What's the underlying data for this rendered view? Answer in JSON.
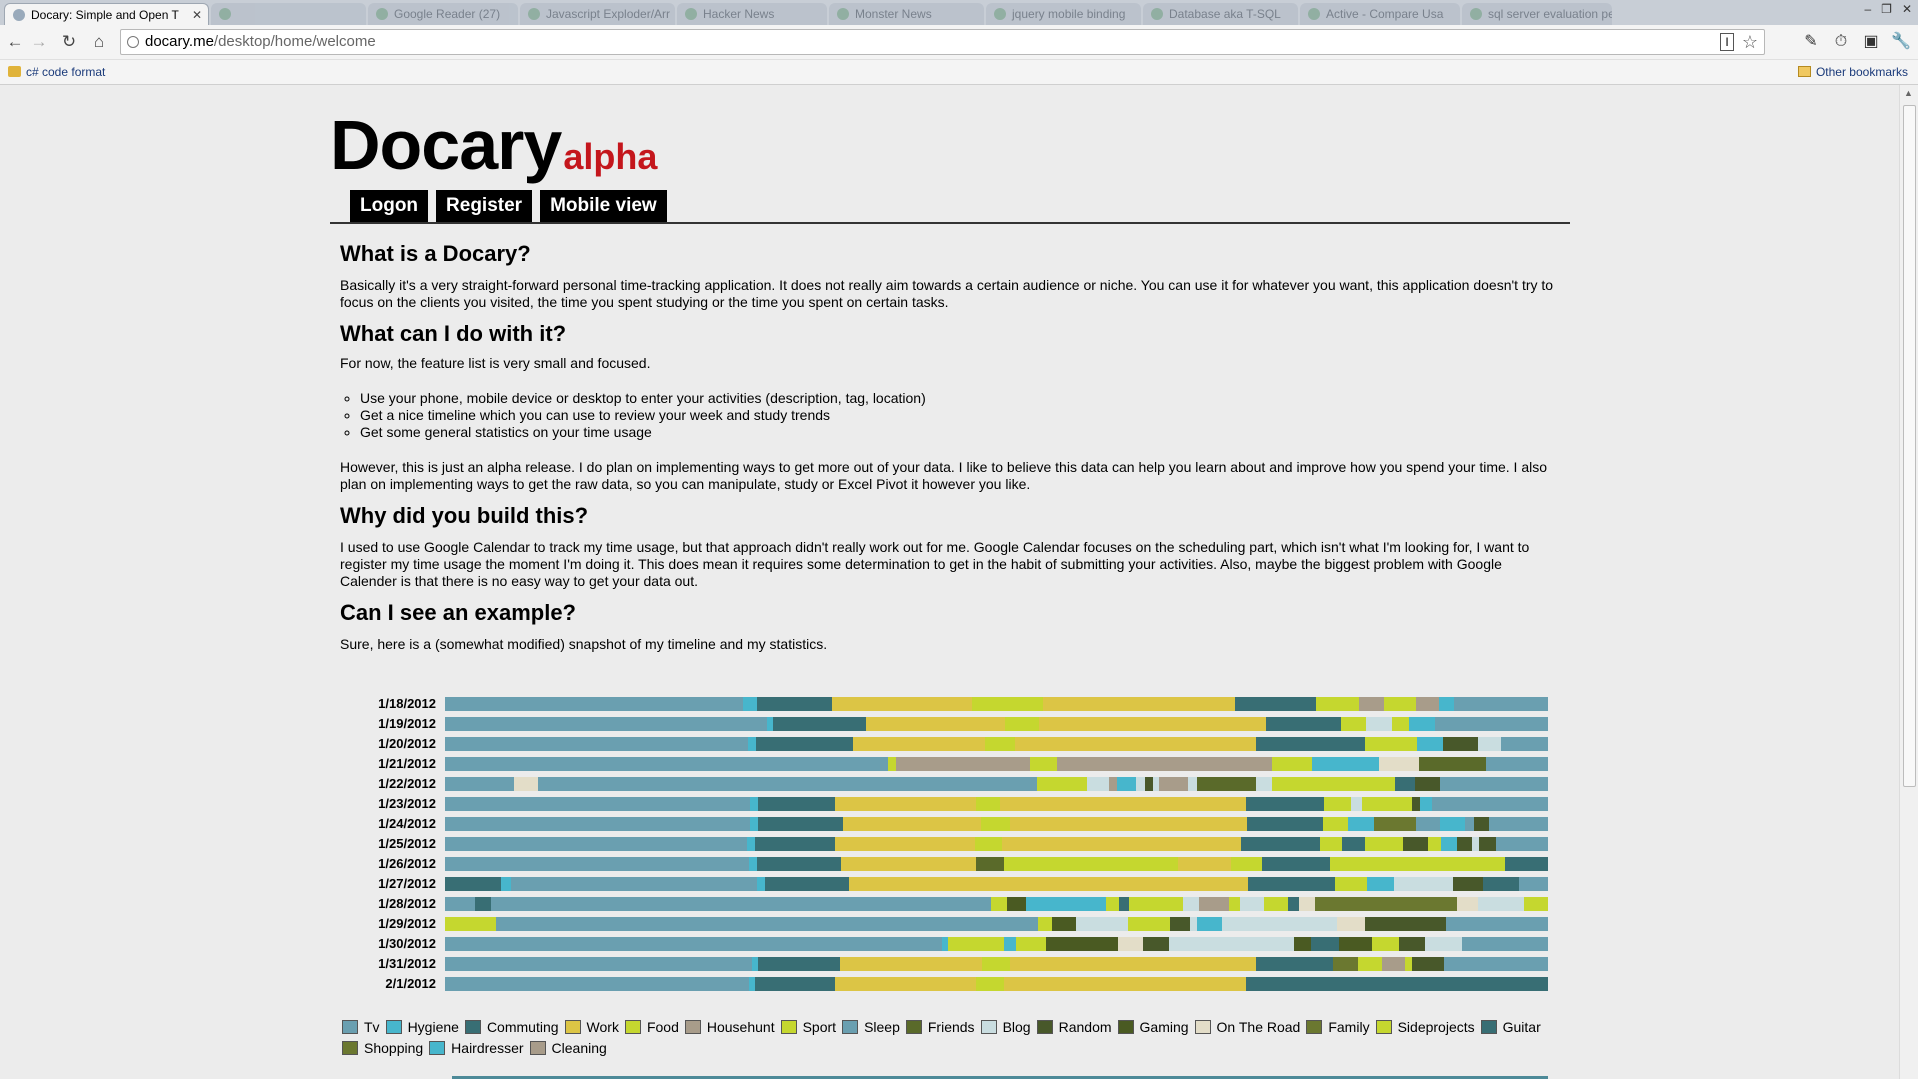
{
  "browser": {
    "tabs": [
      {
        "title": "Docary: Simple and Open T",
        "active": true
      },
      {
        "title": "",
        "active": false
      },
      {
        "title": "Google Reader (27)",
        "active": false
      },
      {
        "title": "Javascript Exploder/Arr",
        "active": false
      },
      {
        "title": "Hacker News",
        "active": false
      },
      {
        "title": "Monster News",
        "active": false
      },
      {
        "title": "jquery mobile binding",
        "active": false
      },
      {
        "title": "Database aka T-SQL",
        "active": false
      },
      {
        "title": "Active - Compare Usa",
        "active": false
      },
      {
        "title": "sql server evaluation pe",
        "active": false
      }
    ],
    "url_host": "docary.me",
    "url_path": "/desktop/home/welcome",
    "bookmarks": {
      "left": "c# code format",
      "right": "Other bookmarks"
    }
  },
  "page": {
    "logo": {
      "name": "Docary",
      "tag": "alpha"
    },
    "menu": [
      "Logon",
      "Register",
      "Mobile view"
    ],
    "sections": {
      "what_heading": "What is a Docary?",
      "what_text": "Basically it's a very straight-forward personal time-tracking application. It does not really aim towards a certain audience or niche. You can use it for whatever you want, this application doesn't try to focus on the clients you visited, the time you spent studying or the time you spent on certain tasks.",
      "do_heading": "What can I do with it?",
      "do_intro": "For now, the feature list is very small and focused.",
      "do_list": [
        "Use your phone, mobile device or desktop to enter your activities (description, tag, location)",
        "Get a nice timeline which you can use to review your week and study trends",
        "Get some general statistics on your time usage"
      ],
      "do_outro": "However, this is just an alpha release. I do plan on implementing ways to get more out of your data. I like to believe this data can help you learn about and improve how you spend your time. I also plan on implementing ways to get the raw data, so you can manipulate, study or Excel Pivot it however you like.",
      "why_heading": "Why did you build this?",
      "why_text": "I used to use Google Calendar to track my time usage, but that approach didn't really work out for me. Google Calendar focuses on the scheduling part, which isn't what I'm looking for, I want to register my time usage the moment I'm doing it. This does mean it requires some determination to get in the habit of submitting your activities. Also, maybe the biggest problem with Google Calender is that there is no easy way to get your data out.",
      "example_heading": "Can I see an example?",
      "example_text": "Sure, here is a (somewhat modified) snapshot of my timeline and my statistics."
    }
  },
  "colors": {
    "Tv": "#6a9fb0",
    "Hygiene": "#47b6cc",
    "Commuting": "#386e74",
    "Work": "#dcc545",
    "Food": "#c5d72f",
    "Househunt": "#a89c8a",
    "Sport": "#c5d72f",
    "Sleep": "#6a9fb0",
    "Friends": "#5a6a2a",
    "Blog": "#c9dde0",
    "Random": "#48582a",
    "Gaming": "#4a5a22",
    "On The Road": "#e3ddc8",
    "Family": "#6b7830",
    "Sideprojects": "#c5d72f",
    "Guitar": "#386e74",
    "Shopping": "#6b7830",
    "Hairdresser": "#47b6cc",
    "Cleaning": "#a89c8a"
  },
  "chart_data": {
    "type": "timeline",
    "legend": [
      "Tv",
      "Hygiene",
      "Commuting",
      "Work",
      "Food",
      "Househunt",
      "Sport",
      "Sleep",
      "Friends",
      "Blog",
      "Random",
      "Gaming",
      "On The Road",
      "Family",
      "Sideprojects",
      "Guitar",
      "Shopping",
      "Hairdresser",
      "Cleaning"
    ],
    "days": [
      {
        "date": "1/18/2012",
        "segments": [
          [
            "Sleep",
            30.3
          ],
          [
            "Hygiene",
            1.4
          ],
          [
            "Commuting",
            7.6
          ],
          [
            "Work",
            14.2
          ],
          [
            "Food",
            7.2
          ],
          [
            "Work",
            19.5
          ],
          [
            "Commuting",
            8.2
          ],
          [
            "Food",
            2.3
          ],
          [
            "Sport",
            2.1
          ],
          [
            "Househunt",
            2.6
          ],
          [
            "Food",
            3.2
          ],
          [
            "Cleaning",
            2.3
          ],
          [
            "Hygiene",
            1.6
          ],
          [
            "Tv",
            9.5
          ]
        ]
      },
      {
        "date": "1/19/2012",
        "segments": [
          [
            "Sleep",
            30.4
          ],
          [
            "Hygiene",
            0.6
          ],
          [
            "Commuting",
            8.7
          ],
          [
            "Work",
            13.2
          ],
          [
            "Food",
            3.2
          ],
          [
            "Work",
            21.4
          ],
          [
            "Commuting",
            7.1
          ],
          [
            "Food",
            2.3
          ],
          [
            "Blog",
            2.5
          ],
          [
            "Food",
            1.6
          ],
          [
            "Hygiene",
            2.4
          ],
          [
            "Tv",
            10.7
          ]
        ]
      },
      {
        "date": "1/20/2012",
        "segments": [
          [
            "Sleep",
            30.4
          ],
          [
            "Hygiene",
            0.8
          ],
          [
            "Commuting",
            9.7
          ],
          [
            "Work",
            13.2
          ],
          [
            "Food",
            3.1
          ],
          [
            "Work",
            24.1
          ],
          [
            "Commuting",
            11
          ],
          [
            "Food",
            5.2
          ],
          [
            "Hygiene",
            2.6
          ],
          [
            "Random",
            3.5
          ],
          [
            "Blog",
            2.3
          ],
          [
            "Tv",
            4.7
          ]
        ]
      },
      {
        "date": "1/21/2012",
        "segments": [
          [
            "Sleep",
            44.3
          ],
          [
            "Food",
            0.8
          ],
          [
            "Househunt",
            13.5
          ],
          [
            "Sport",
            2.7
          ],
          [
            "Househunt",
            21.5
          ],
          [
            "Food",
            4
          ],
          [
            "Hygiene",
            6.7
          ],
          [
            "On The Road",
            4
          ],
          [
            "Friends",
            6.7
          ],
          [
            "Tv",
            6.2
          ]
        ]
      },
      {
        "date": "1/22/2012",
        "segments": [
          [
            "Sleep",
            6.8
          ],
          [
            "On The Road",
            2.4
          ],
          [
            "Tv",
            49.4
          ],
          [
            "Food",
            5
          ],
          [
            "Blog",
            2.1
          ],
          [
            "Househunt",
            0.8
          ],
          [
            "Hygiene",
            1.9
          ],
          [
            "Blog",
            0.9
          ],
          [
            "Random",
            0.8
          ],
          [
            "Blog",
            0.6
          ],
          [
            "Cleaning",
            2.9
          ],
          [
            "Blog",
            0.9
          ],
          [
            "Friends",
            5.8
          ],
          [
            "Blog",
            1.6
          ],
          [
            "Sport",
            12.2
          ],
          [
            "Commuting",
            1.9
          ],
          [
            "Random",
            2.5
          ],
          [
            "Tv",
            10.7
          ]
        ]
      },
      {
        "date": "1/23/2012",
        "segments": [
          [
            "Sleep",
            30.5
          ],
          [
            "Hygiene",
            0.8
          ],
          [
            "Commuting",
            7.7
          ],
          [
            "Work",
            14.2
          ],
          [
            "Food",
            2.4
          ],
          [
            "Work",
            24.6
          ],
          [
            "Commuting",
            7.8
          ],
          [
            "Food",
            2.7
          ],
          [
            "Blog",
            1.1
          ],
          [
            "Food",
            5
          ],
          [
            "Random",
            0.8
          ],
          [
            "Hygiene",
            1.2
          ],
          [
            "Tv",
            11.6
          ]
        ]
      },
      {
        "date": "1/24/2012",
        "segments": [
          [
            "Sleep",
            30.4
          ],
          [
            "Hygiene",
            0.8
          ],
          [
            "Commuting",
            8.4
          ],
          [
            "Work",
            13.8
          ],
          [
            "Food",
            2.8
          ],
          [
            "Work",
            23.6
          ],
          [
            "Commuting",
            7.6
          ],
          [
            "Food",
            2.5
          ],
          [
            "Hygiene",
            2.6
          ],
          [
            "Family",
            4.2
          ],
          [
            "Tv",
            2.4
          ],
          [
            "Hygiene",
            2.4
          ],
          [
            "Tv",
            0.9
          ],
          [
            "Random",
            1.5
          ],
          [
            "Tv",
            5.9
          ]
        ]
      },
      {
        "date": "1/25/2012",
        "segments": [
          [
            "Sleep",
            30.4
          ],
          [
            "Hygiene",
            0.8
          ],
          [
            "Commuting",
            8
          ],
          [
            "Work",
            14.1
          ],
          [
            "Food",
            2.8
          ],
          [
            "Work",
            24
          ],
          [
            "Commuting",
            8
          ],
          [
            "Food",
            2.2
          ],
          [
            "Commuting",
            2.3
          ],
          [
            "Food",
            3.8
          ],
          [
            "Random",
            2.5
          ],
          [
            "Food",
            1.3
          ],
          [
            "Hygiene",
            1.7
          ],
          [
            "Random",
            1.5
          ],
          [
            "Blog",
            0.7
          ],
          [
            "Random",
            1.7
          ],
          [
            "Tv",
            5.2
          ]
        ]
      },
      {
        "date": "1/26/2012",
        "segments": [
          [
            "Sleep",
            30.3
          ],
          [
            "Hygiene",
            0.8
          ],
          [
            "Commuting",
            8.4
          ],
          [
            "Work",
            13.5
          ],
          [
            "Friends",
            2.8
          ],
          [
            "Sport",
            17.3
          ],
          [
            "Work",
            5.3
          ],
          [
            "Sport",
            3.1
          ],
          [
            "Commuting",
            6.8
          ],
          [
            "Sport",
            17.4
          ],
          [
            "Commuting",
            4.3
          ]
        ]
      },
      {
        "date": "1/27/2012",
        "segments": [
          [
            "Commuting",
            5.5
          ],
          [
            "Hygiene",
            1
          ],
          [
            "Sleep",
            24.3
          ],
          [
            "Hygiene",
            0.8
          ],
          [
            "Commuting",
            8.3
          ],
          [
            "Work",
            39.3
          ],
          [
            "Commuting",
            8.6
          ],
          [
            "Food",
            3.2
          ],
          [
            "Hygiene",
            2.6
          ],
          [
            "Blog",
            5.8
          ],
          [
            "Random",
            3
          ],
          [
            "Commuting",
            3.5
          ],
          [
            "Tv",
            2.9
          ]
        ]
      },
      {
        "date": "1/28/2012",
        "segments": [
          [
            "Tv",
            2.9
          ],
          [
            "Commuting",
            1.6
          ],
          [
            "Sleep",
            48.8
          ],
          [
            "Food",
            1.6
          ],
          [
            "Gaming",
            1.8
          ],
          [
            "Hygiene",
            7.8
          ],
          [
            "Food",
            1.3
          ],
          [
            "Commuting",
            1
          ],
          [
            "Food",
            5.3
          ],
          [
            "Blog",
            1.5
          ],
          [
            "Househunt",
            3
          ],
          [
            "Food",
            1
          ],
          [
            "Blog",
            2.4
          ],
          [
            "Food",
            2.3
          ],
          [
            "Commuting",
            1.1
          ],
          [
            "On The Road",
            1.6
          ],
          [
            "Family",
            13.8
          ],
          [
            "On The Road",
            2.1
          ],
          [
            "Blog",
            4.5
          ],
          [
            "Food",
            2.3
          ]
        ]
      },
      {
        "date": "1/29/2012",
        "segments": [
          [
            "Food",
            4.9
          ],
          [
            "Tv",
            52
          ],
          [
            "Food",
            1.3
          ],
          [
            "Gaming",
            2.3
          ],
          [
            "Blog",
            5
          ],
          [
            "Food",
            4
          ],
          [
            "Random",
            2
          ],
          [
            "Blog",
            0.6
          ],
          [
            "Hygiene",
            2.4
          ],
          [
            "Blog",
            7.1
          ],
          [
            "Blog",
            4
          ],
          [
            "On The Road",
            2.7
          ],
          [
            "Random",
            7.7
          ],
          [
            "Tv",
            9.8
          ]
        ]
      },
      {
        "date": "1/30/2012",
        "segments": [
          [
            "Sleep",
            50.7
          ],
          [
            "Hygiene",
            0.6
          ],
          [
            "Food",
            5.7
          ],
          [
            "Hygiene",
            1.2
          ],
          [
            "Food",
            3.1
          ],
          [
            "Gaming",
            7.3
          ],
          [
            "On The Road",
            2.6
          ],
          [
            "Random",
            2.6
          ],
          [
            "Blog",
            12.8
          ],
          [
            "Gaming",
            1.7
          ],
          [
            "Commuting",
            2.9
          ],
          [
            "Gaming",
            3.4
          ],
          [
            "Food",
            2.7
          ],
          [
            "Random",
            2.7
          ],
          [
            "Blog",
            3.7
          ],
          [
            "Tv",
            8.8
          ]
        ]
      },
      {
        "date": "1/31/2012",
        "segments": [
          [
            "Sleep",
            30.3
          ],
          [
            "Hygiene",
            0.6
          ],
          [
            "Commuting",
            8.1
          ],
          [
            "Work",
            14.1
          ],
          [
            "Food",
            2.7
          ],
          [
            "Work",
            24.3
          ],
          [
            "Commuting",
            7.7
          ],
          [
            "Family",
            2.4
          ],
          [
            "Food",
            2.4
          ],
          [
            "Cleaning",
            2.3
          ],
          [
            "Food",
            0.7
          ],
          [
            "Random",
            3.1
          ],
          [
            "Tv",
            10.3
          ]
        ]
      },
      {
        "date": "2/1/2012",
        "segments": [
          [
            "Sleep",
            30.3
          ],
          [
            "Hygiene",
            0.6
          ],
          [
            "Commuting",
            8
          ],
          [
            "Work",
            14
          ],
          [
            "Food",
            2.8
          ],
          [
            "Work",
            24.1
          ],
          [
            "Commuting",
            30.1
          ]
        ]
      }
    ]
  }
}
